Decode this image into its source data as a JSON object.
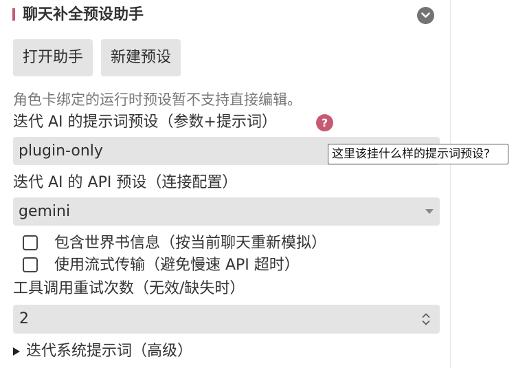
{
  "panel": {
    "title": "聊天补全预设助手",
    "accent_color": "#c65a73",
    "collapse_icon": "chevron-down-icon"
  },
  "buttons": {
    "open_label": "打开助手",
    "new_label": "新建预设"
  },
  "note": "角色卡绑定的运行时预设暂不支持直接编辑。",
  "prompt_preset": {
    "label": "迭代 AI 的提示词预设（参数+提示词）",
    "help_icon": "question-icon",
    "help_glyph": "?",
    "value": "plugin-only",
    "tooltip": "这里该挂什么样的提示词预设?"
  },
  "api_preset": {
    "label": "迭代 AI 的 API 预设（连接配置）",
    "value": "gemini"
  },
  "options": [
    {
      "label": "包含世界书信息（按当前聊天重新模拟）",
      "checked": false
    },
    {
      "label": "使用流式传输（避免慢速 API 超时）",
      "checked": false
    }
  ],
  "retry": {
    "label": "工具调用重试次数（无效/缺失时）",
    "value": "2"
  },
  "advanced": {
    "label": "迭代系统提示词（高级）",
    "expanded": false
  }
}
